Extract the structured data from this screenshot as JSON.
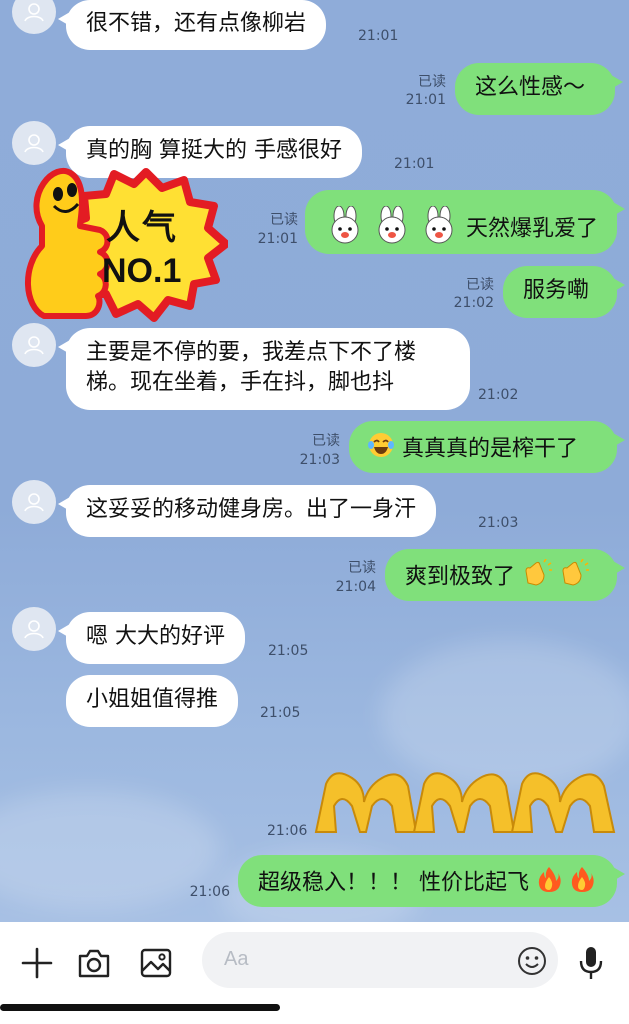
{
  "messages": [
    {
      "side": "in",
      "text": "很不错，还有点像柳岩",
      "time": "21:01"
    },
    {
      "side": "out",
      "text": "这么性感～",
      "read": "已读",
      "time": "21:01"
    },
    {
      "side": "in",
      "text": "真的胸 算挺大的 手感很好",
      "time": "21:01"
    },
    {
      "side": "out",
      "text": "天然爆乳爱了",
      "read": "已读",
      "time": "21:01"
    },
    {
      "side": "out",
      "text": "服务嘞",
      "read": "已读",
      "time": "21:02"
    },
    {
      "side": "in",
      "lines": [
        "主要是不停的要，我差点下不了楼",
        "梯。现在坐着，手在抖，脚也抖"
      ],
      "time": "21:02"
    },
    {
      "side": "out",
      "text": "真真真的是榨干了",
      "read": "已读",
      "time": "21:03"
    },
    {
      "side": "in",
      "text": "这妥妥的移动健身房。出了一身汗",
      "time": "21:03"
    },
    {
      "side": "out",
      "text": "爽到极致了",
      "read": "已读",
      "time": "21:04"
    },
    {
      "side": "in",
      "text": "嗯 大大的好评",
      "time": "21:05"
    },
    {
      "side": "in",
      "text": "小姐姐值得推",
      "time": "21:05"
    },
    {
      "side": "out",
      "sticker": "heart-hands",
      "time": "21:06"
    },
    {
      "side": "out",
      "text": "超级稳入！！！ 性价比起飞",
      "time": "21:06"
    }
  ],
  "badge": {
    "line1": "人气",
    "line2": "NO.1"
  },
  "composer": {
    "placeholder": "Aa"
  },
  "colors": {
    "background": "#8facd9",
    "incoming_bubble": "#ffffff",
    "outgoing_bubble": "#80e07b",
    "meta_text": "#3e4f6a"
  },
  "icons": [
    "avatar-icon",
    "bunny-emoji-icon",
    "laughing-tears-emoji-icon",
    "clapping-hands-emoji-icon",
    "fire-emoji-icon",
    "heart-hands-sticker",
    "plus-icon",
    "camera-icon",
    "image-icon",
    "smiley-icon",
    "microphone-icon"
  ]
}
